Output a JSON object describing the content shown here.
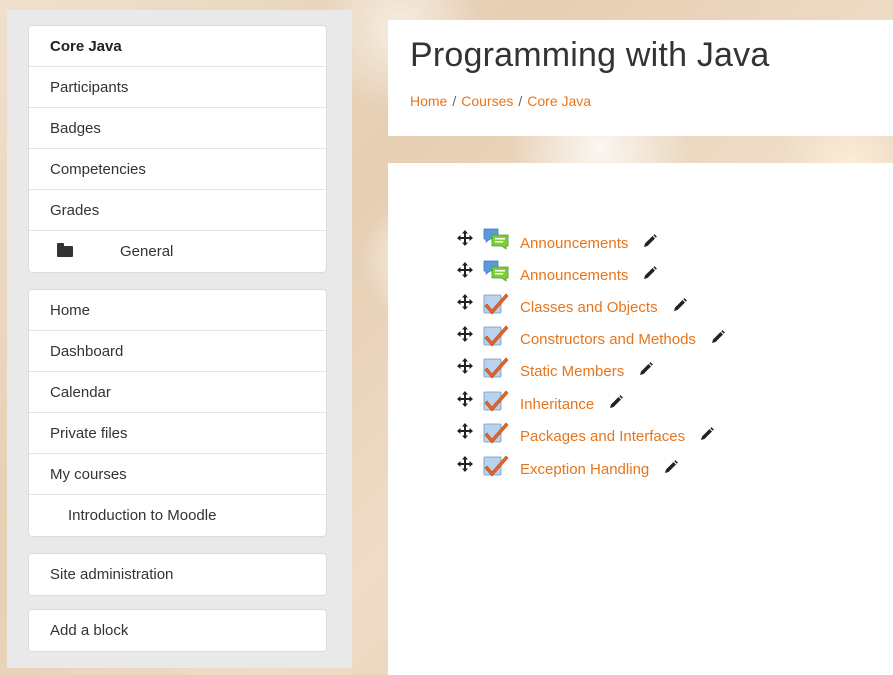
{
  "course_nav": {
    "items": [
      {
        "label": "Core Java"
      },
      {
        "label": "Participants"
      },
      {
        "label": "Badges"
      },
      {
        "label": "Competencies"
      },
      {
        "label": "Grades"
      },
      {
        "label": "General",
        "icon": "folder-icon"
      }
    ]
  },
  "site_nav": {
    "items": [
      {
        "label": "Home"
      },
      {
        "label": "Dashboard"
      },
      {
        "label": "Calendar"
      },
      {
        "label": "Private files"
      },
      {
        "label": "My courses"
      },
      {
        "label": "Introduction to Moodle"
      }
    ]
  },
  "admin_block": {
    "label": "Site administration"
  },
  "add_block": {
    "label": "Add a block"
  },
  "header": {
    "title": "Programming with Java",
    "breadcrumb": [
      "Home",
      "Courses",
      "Core Java"
    ],
    "breadcrumb_separator": "/"
  },
  "activities": [
    {
      "label": "Announcements",
      "icon": "forum-icon"
    },
    {
      "label": "Announcements",
      "icon": "forum-icon"
    },
    {
      "label": "Classes and Objects",
      "icon": "assignment-check-icon"
    },
    {
      "label": "Constructors and Methods",
      "icon": "assignment-check-icon"
    },
    {
      "label": "Static Members",
      "icon": "assignment-check-icon"
    },
    {
      "label": "Inheritance",
      "icon": "assignment-check-icon"
    },
    {
      "label": "Packages and Interfaces",
      "icon": "assignment-check-icon"
    },
    {
      "label": "Exception Handling",
      "icon": "assignment-check-icon"
    }
  ],
  "colors": {
    "link": "#e8751a",
    "text": "#333333",
    "sidebar_bg": "#e9e9e9"
  }
}
